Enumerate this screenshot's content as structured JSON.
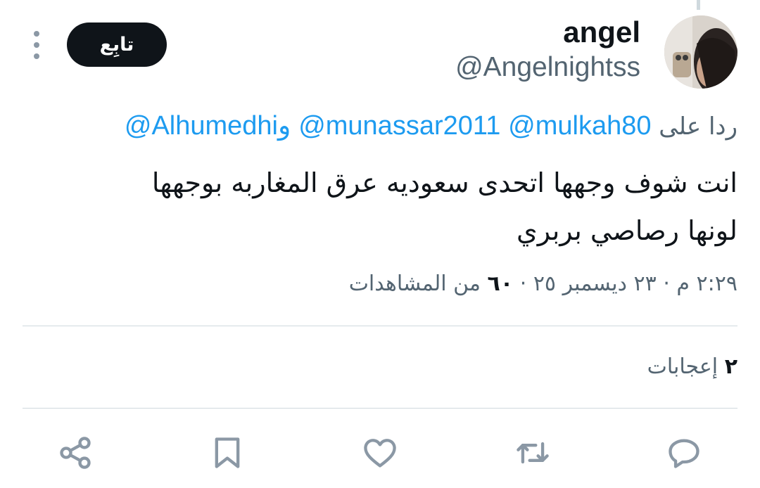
{
  "user": {
    "name": "angel",
    "handle": "@Angelnightss"
  },
  "header": {
    "follow_label": "تابِع",
    "more_icon": "more-vertical-icon"
  },
  "reply": {
    "prefix": "ردا على",
    "mention1": "@mulkah80",
    "mention2": "@munassar2011",
    "and": "و",
    "mention3": "@Alhumedhi"
  },
  "tweet": {
    "line1": "انت شوف وجهها اتحدى سعوديه عرق المغاربه بوجهها",
    "line2": "لونها رصاصي بربري"
  },
  "meta": {
    "time": "٢:٢٩ م",
    "dot1": "·",
    "date": "٢٣ ديسمبر ٢٥",
    "dot2": "·",
    "views_count": "٦٠",
    "views_label": "من المشاهدات"
  },
  "stats": {
    "likes_count": "٢",
    "likes_label": "إعجابات"
  },
  "actions": [
    "reply-icon",
    "retweet-icon",
    "like-icon",
    "bookmark-icon",
    "share-icon"
  ],
  "colors": {
    "link": "#1d9bf0",
    "secondary_text": "#536471",
    "primary_text": "#0f1419",
    "icon": "#8b98a5",
    "divider": "#cfd9de"
  }
}
